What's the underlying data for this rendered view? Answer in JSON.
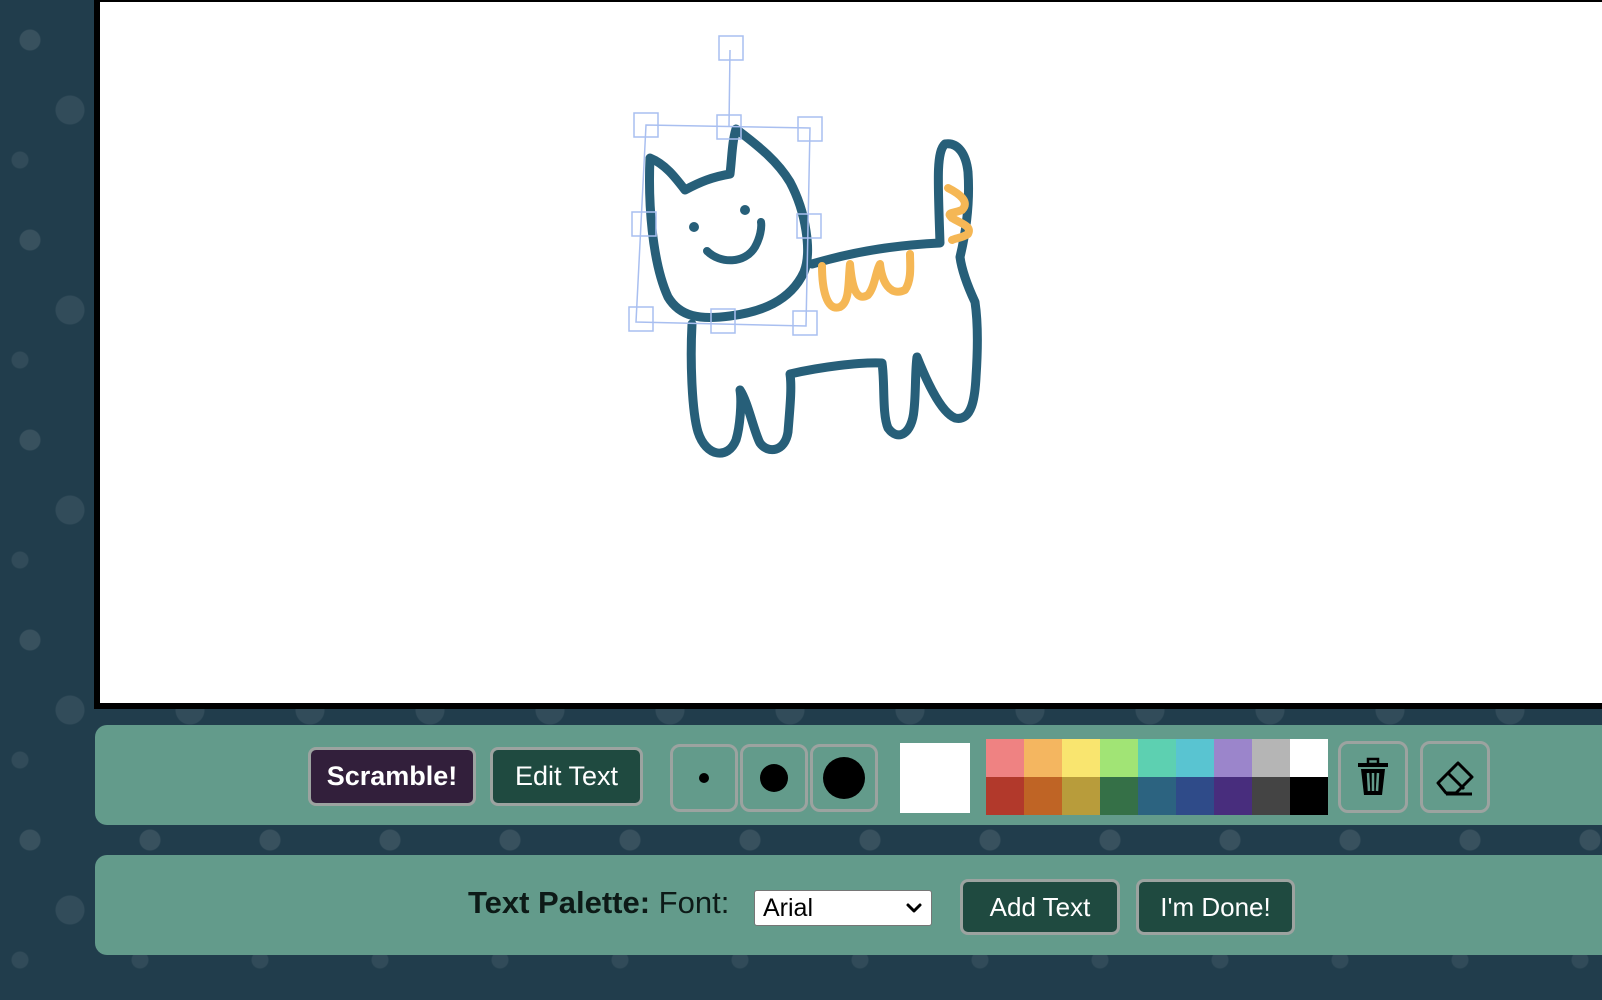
{
  "toolbar": {
    "scramble_label": "Scramble!",
    "edit_text_label": "Edit Text",
    "brush_sizes": [
      "small-brush",
      "medium-brush",
      "large-brush"
    ],
    "current_color": "#ffffff",
    "colors": [
      "#ef8282",
      "#f4b660",
      "#f9e56f",
      "#a1e475",
      "#5dd0b1",
      "#59c4d1",
      "#9b85cb",
      "#b5b5b5",
      "#ffffff",
      "#b2392b",
      "#bf6425",
      "#b89c3b",
      "#357047",
      "#2c6380",
      "#2f4b89",
      "#482d7d",
      "#444444",
      "#000000"
    ],
    "delete_icon": "trash-icon",
    "eraser_icon": "eraser-icon"
  },
  "text_palette": {
    "title": "Text Palette:",
    "font_label": "Font:",
    "font_value": "Arial",
    "add_text_label": "Add Text",
    "done_label": "I'm Done!"
  },
  "drawing": {
    "stroke_color": "#275f79",
    "accent_color": "#f5b755",
    "selection_color": "#a9bff0"
  }
}
